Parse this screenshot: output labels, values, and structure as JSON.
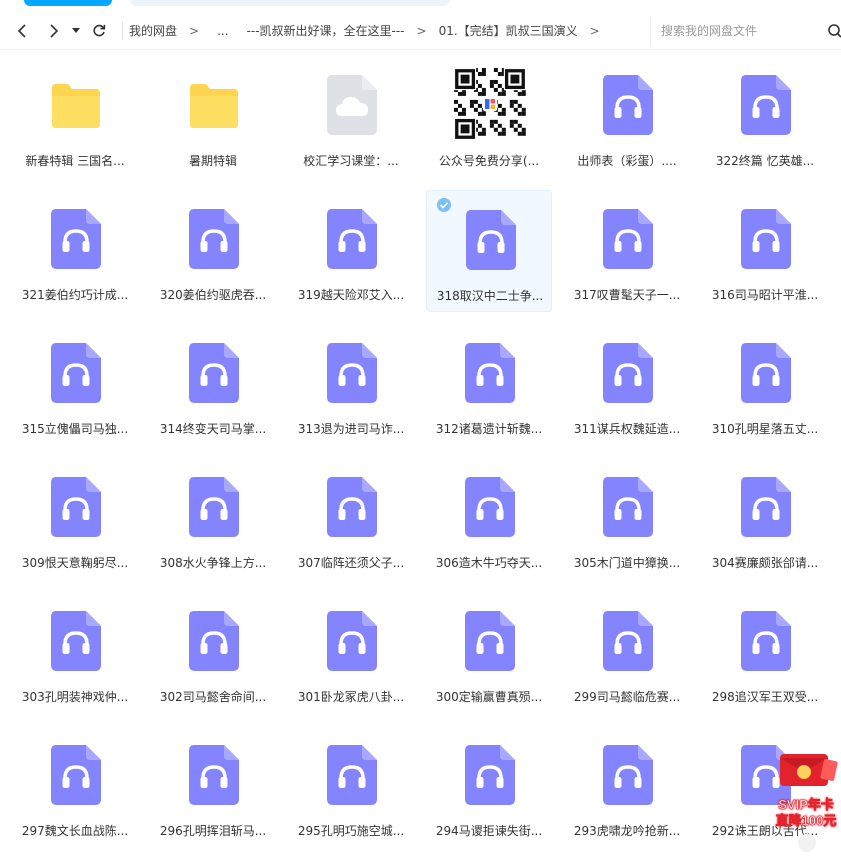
{
  "breadcrumb": {
    "items": [
      "我的网盘",
      "...",
      "---凯叔新出好课，全在这里---",
      "01.【完结】凯叔三国演义"
    ],
    "separator": ">"
  },
  "search": {
    "placeholder": "搜索我的网盘文件"
  },
  "colors": {
    "folder": "#ffd54f",
    "audio": "#8584ff",
    "cloud_bg": "#dfe1e6",
    "accent": "#06a7ff",
    "promo_red": "#e3232c"
  },
  "files": [
    {
      "name": "新春特辑 三国名...",
      "type": "folder"
    },
    {
      "name": "暑期特辑",
      "type": "folder"
    },
    {
      "name": "校汇学习课堂：...",
      "type": "cloud"
    },
    {
      "name": "公众号免费分享(...",
      "type": "qrcode"
    },
    {
      "name": "出师表（彩蛋）....",
      "type": "audio"
    },
    {
      "name": "322终篇 忆英雄...",
      "type": "audio"
    },
    {
      "name": "321姜伯约巧计成...",
      "type": "audio"
    },
    {
      "name": "320姜伯约驱虎吞...",
      "type": "audio"
    },
    {
      "name": "319越天险邓艾入...",
      "type": "audio"
    },
    {
      "name": "318取汉中二士争...",
      "type": "audio",
      "selected": true
    },
    {
      "name": "317叹曹髦天子一...",
      "type": "audio"
    },
    {
      "name": "316司马昭计平淮...",
      "type": "audio"
    },
    {
      "name": "315立傀儡司马独...",
      "type": "audio"
    },
    {
      "name": "314终变天司马掌...",
      "type": "audio"
    },
    {
      "name": "313退为进司马诈...",
      "type": "audio"
    },
    {
      "name": "312诸葛遗计斩魏...",
      "type": "audio"
    },
    {
      "name": "311谋兵权魏延造...",
      "type": "audio"
    },
    {
      "name": "310孔明星落五丈...",
      "type": "audio"
    },
    {
      "name": "309恨天意鞠躬尽...",
      "type": "audio"
    },
    {
      "name": "308水火争锋上方...",
      "type": "audio"
    },
    {
      "name": "307临阵还须父子...",
      "type": "audio"
    },
    {
      "name": "306造木牛巧夺天...",
      "type": "audio"
    },
    {
      "name": "305木门道中獐换...",
      "type": "audio"
    },
    {
      "name": "304赛廉颇张郃请...",
      "type": "audio"
    },
    {
      "name": "303孔明装神戏仲...",
      "type": "audio"
    },
    {
      "name": "302司马懿舍命间...",
      "type": "audio"
    },
    {
      "name": "301卧龙冢虎八卦...",
      "type": "audio"
    },
    {
      "name": "300定输赢曹真殒...",
      "type": "audio"
    },
    {
      "name": "299司马懿临危赛...",
      "type": "audio"
    },
    {
      "name": "298追汉军王双受...",
      "type": "audio"
    },
    {
      "name": "297魏文长血战陈...",
      "type": "audio"
    },
    {
      "name": "296孔明挥泪斩马...",
      "type": "audio"
    },
    {
      "name": "295孔明巧施空城...",
      "type": "audio"
    },
    {
      "name": "294马谡拒谏失街...",
      "type": "audio"
    },
    {
      "name": "293虎啸龙吟抢新...",
      "type": "audio"
    },
    {
      "name": "292诛王朗以舌代...",
      "type": "audio"
    }
  ],
  "promo": {
    "line1": "SVIP年卡",
    "line2": "直降100元"
  }
}
